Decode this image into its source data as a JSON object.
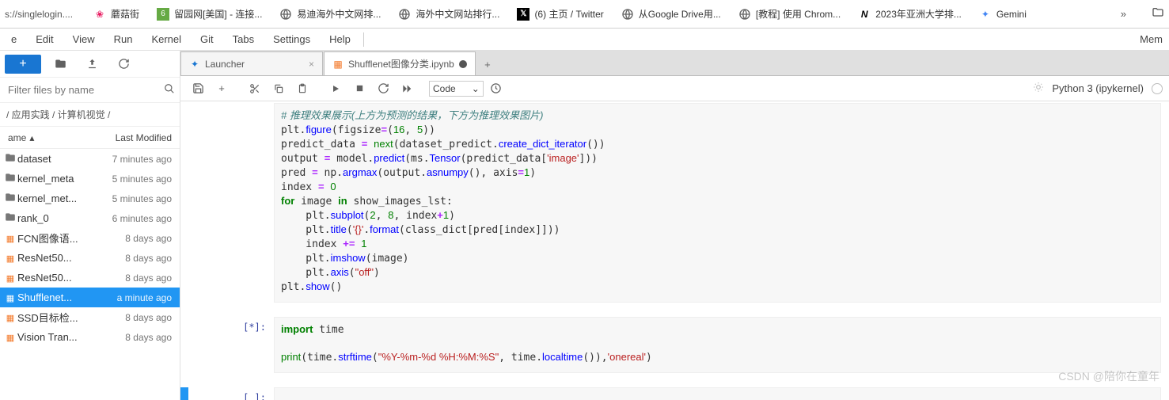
{
  "url_fragment": "s://singlelogin....",
  "bookmarks": [
    {
      "icon": "mogu",
      "label": "蘑菇街"
    },
    {
      "icon": "liu",
      "label": "留园网[美国] - 连接..."
    },
    {
      "icon": "globe",
      "label": "易迪海外中文网排..."
    },
    {
      "icon": "globe",
      "label": "海外中文网站排行..."
    },
    {
      "icon": "x",
      "label": "(6) 主页 / Twitter"
    },
    {
      "icon": "globe",
      "label": "从Google Drive用..."
    },
    {
      "icon": "globe",
      "label": "[教程] 使用 Chrom..."
    },
    {
      "icon": "n",
      "label": "2023年亚洲大学排..."
    },
    {
      "icon": "gemini",
      "label": "Gemini"
    }
  ],
  "menu": [
    "e",
    "Edit",
    "View",
    "Run",
    "Kernel",
    "Git",
    "Tabs",
    "Settings",
    "Help"
  ],
  "mem_label": "Mem",
  "sidebar": {
    "filter_placeholder": "Filter files by name",
    "breadcrumb": "/ 应用实践 / 计算机视觉 /",
    "header_name": "ame",
    "header_mod": "Last Modified",
    "files": [
      {
        "type": "folder",
        "name": "dataset",
        "mod": "7 minutes ago"
      },
      {
        "type": "folder",
        "name": "kernel_meta",
        "mod": "5 minutes ago"
      },
      {
        "type": "folder",
        "name": "kernel_met...",
        "mod": "5 minutes ago"
      },
      {
        "type": "folder",
        "name": "rank_0",
        "mod": "6 minutes ago"
      },
      {
        "type": "nb",
        "name": "FCN图像语...",
        "mod": "8 days ago"
      },
      {
        "type": "nb",
        "name": "ResNet50...",
        "mod": "8 days ago"
      },
      {
        "type": "nb",
        "name": "ResNet50...",
        "mod": "8 days ago"
      },
      {
        "type": "nb",
        "name": "Shufflenet...",
        "mod": "a minute ago",
        "selected": true
      },
      {
        "type": "nb",
        "name": "SSD目标检...",
        "mod": "8 days ago"
      },
      {
        "type": "nb",
        "name": "Vision Tran...",
        "mod": "8 days ago"
      }
    ]
  },
  "tabs": [
    {
      "icon": "launcher",
      "label": "Launcher",
      "active": false,
      "dirty": false
    },
    {
      "icon": "nb",
      "label": "Shufflenet图像分类.ipynb",
      "active": true,
      "dirty": true
    }
  ],
  "celltype": "Code",
  "kernel": "Python 3 (ipykernel)",
  "code_cell_1": {
    "prompt": "",
    "lines": [
      {
        "t": "cm",
        "x": "# 推理效果展示(上方为预测的结果，下方为推理效果图片)"
      },
      {
        "t": "code",
        "x": "plt.<fn>figure</fn>(figsize<op>=</op>(<nm>16</nm>, <nm>5</nm>))"
      },
      {
        "t": "code",
        "x": "predict_data <op>=</op> <bi>next</bi>(dataset_predict.<fn>create_dict_iterator</fn>())"
      },
      {
        "t": "code",
        "x": "output <op>=</op> model.<fn>predict</fn>(ms.<fn>Tensor</fn>(predict_data[<st>'image'</st>]))"
      },
      {
        "t": "code",
        "x": "pred <op>=</op> np.<fn>argmax</fn>(output.<fn>asnumpy</fn>(), axis<op>=</op><nm>1</nm>)"
      },
      {
        "t": "code",
        "x": "index <op>=</op> <nm>0</nm>"
      },
      {
        "t": "code",
        "x": "<kw>for</kw> image <kw>in</kw> show_images_lst:"
      },
      {
        "t": "code",
        "x": "    plt.<fn>subplot</fn>(<nm>2</nm>, <nm>8</nm>, index<op>+</op><nm>1</nm>)"
      },
      {
        "t": "code",
        "x": "    plt.<fn>title</fn>(<st>'{}'</st>.<fn>format</fn>(class_dict[pred[index]]))"
      },
      {
        "t": "code",
        "x": "    index <op>+=</op> <nm>1</nm>"
      },
      {
        "t": "code",
        "x": "    plt.<fn>imshow</fn>(image)"
      },
      {
        "t": "code",
        "x": "    plt.<fn>axis</fn>(<st>\"off\"</st>)"
      },
      {
        "t": "code",
        "x": "plt.<fn>show</fn>()"
      }
    ]
  },
  "code_cell_2": {
    "prompt": "[*]:",
    "lines": [
      {
        "t": "code",
        "x": "<kw>import</kw> time"
      },
      {
        "t": "code",
        "x": ""
      },
      {
        "t": "code",
        "x": "<bi>print</bi>(time.<fn>strftime</fn>(<st>\"%Y-%m-%d %H:%M:%S\"</st>, time.<fn>localtime</fn>()),<st>'onereal'</st>)"
      }
    ]
  },
  "code_cell_3": {
    "prompt": "[ ]:"
  },
  "watermark": "CSDN @陪你在童年"
}
